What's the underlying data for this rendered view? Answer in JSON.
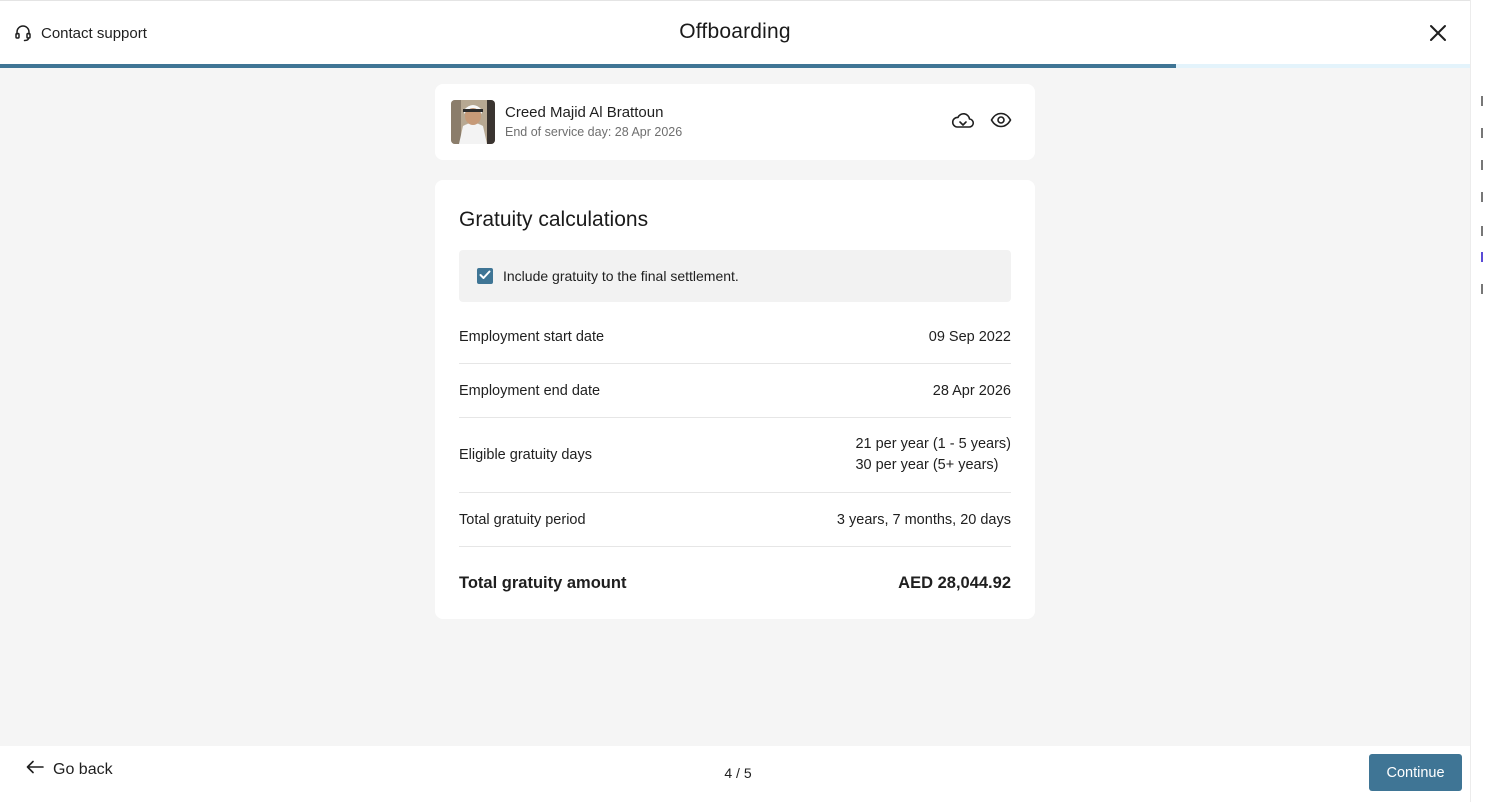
{
  "header": {
    "contact_support": "Contact support",
    "title": "Offboarding",
    "progress_fraction": 0.8
  },
  "employee": {
    "name": "Creed Majid Al Brattoun",
    "end_of_service": "End of service day: 28 Apr 2026"
  },
  "gratuity": {
    "title": "Gratuity calculations",
    "include_label": "Include gratuity to the final settlement.",
    "include_checked": true,
    "rows": [
      {
        "label": "Employment start date",
        "value": "09 Sep 2022"
      },
      {
        "label": "Employment end date",
        "value": "28 Apr 2026"
      },
      {
        "label": "Eligible gratuity days",
        "value_lines": [
          "21 per year (1 - 5 years)",
          "30 per year (5+ years)"
        ]
      },
      {
        "label": "Total gratuity period",
        "value": "3 years, 7 months, 20 days"
      }
    ],
    "total_label": "Total gratuity amount",
    "total_value": "AED 28,044.92"
  },
  "footer": {
    "go_back": "Go back",
    "step": "4 / 5",
    "continue": "Continue"
  },
  "colors": {
    "accent": "#3f7595",
    "progress_track": "#e3f3fb",
    "background": "#f5f5f5"
  }
}
